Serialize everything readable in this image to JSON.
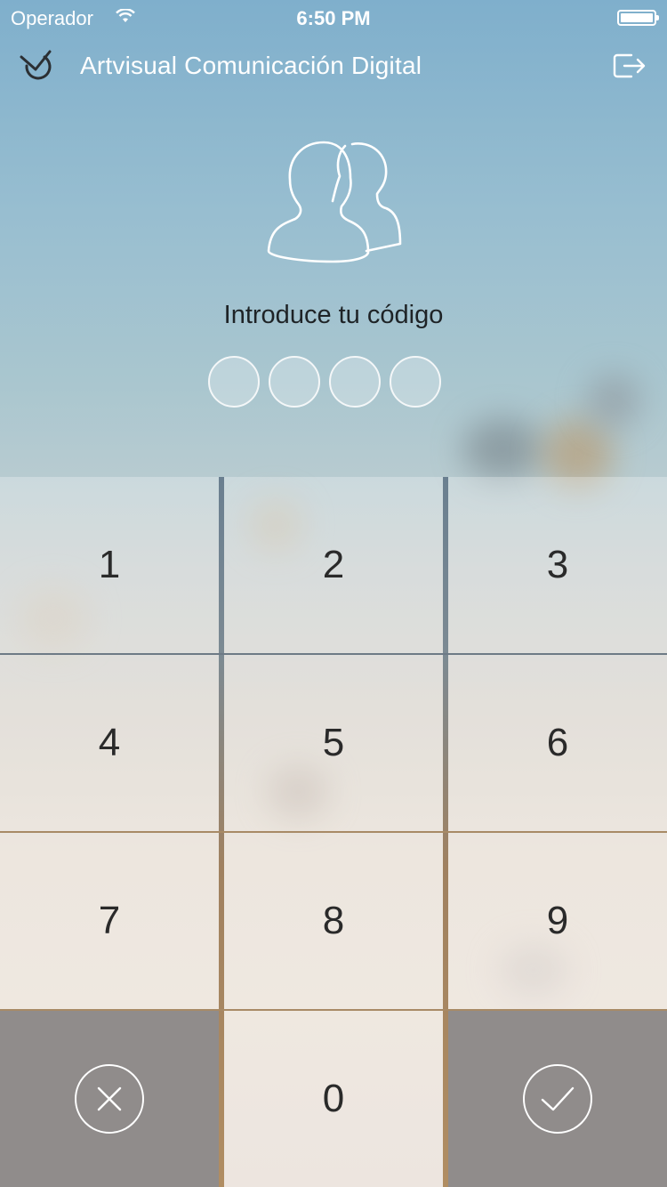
{
  "status_bar": {
    "carrier": "Operador",
    "time": "6:50 PM"
  },
  "header": {
    "title": "Artvisual Comunicación Digital",
    "logo_icon": "clock-check-icon",
    "logout_icon": "logout-icon"
  },
  "login": {
    "avatar_icon": "users-icon",
    "prompt": "Introduce tu código",
    "pin_length": 4,
    "pin_filled": 0
  },
  "keypad": {
    "keys": [
      "1",
      "2",
      "3",
      "4",
      "5",
      "6",
      "7",
      "8",
      "9",
      "0"
    ],
    "cancel_icon": "close-icon",
    "confirm_icon": "check-icon"
  },
  "colors": {
    "text": "#1e2326",
    "action_key_bg": "#908c8b",
    "white": "#ffffff"
  }
}
